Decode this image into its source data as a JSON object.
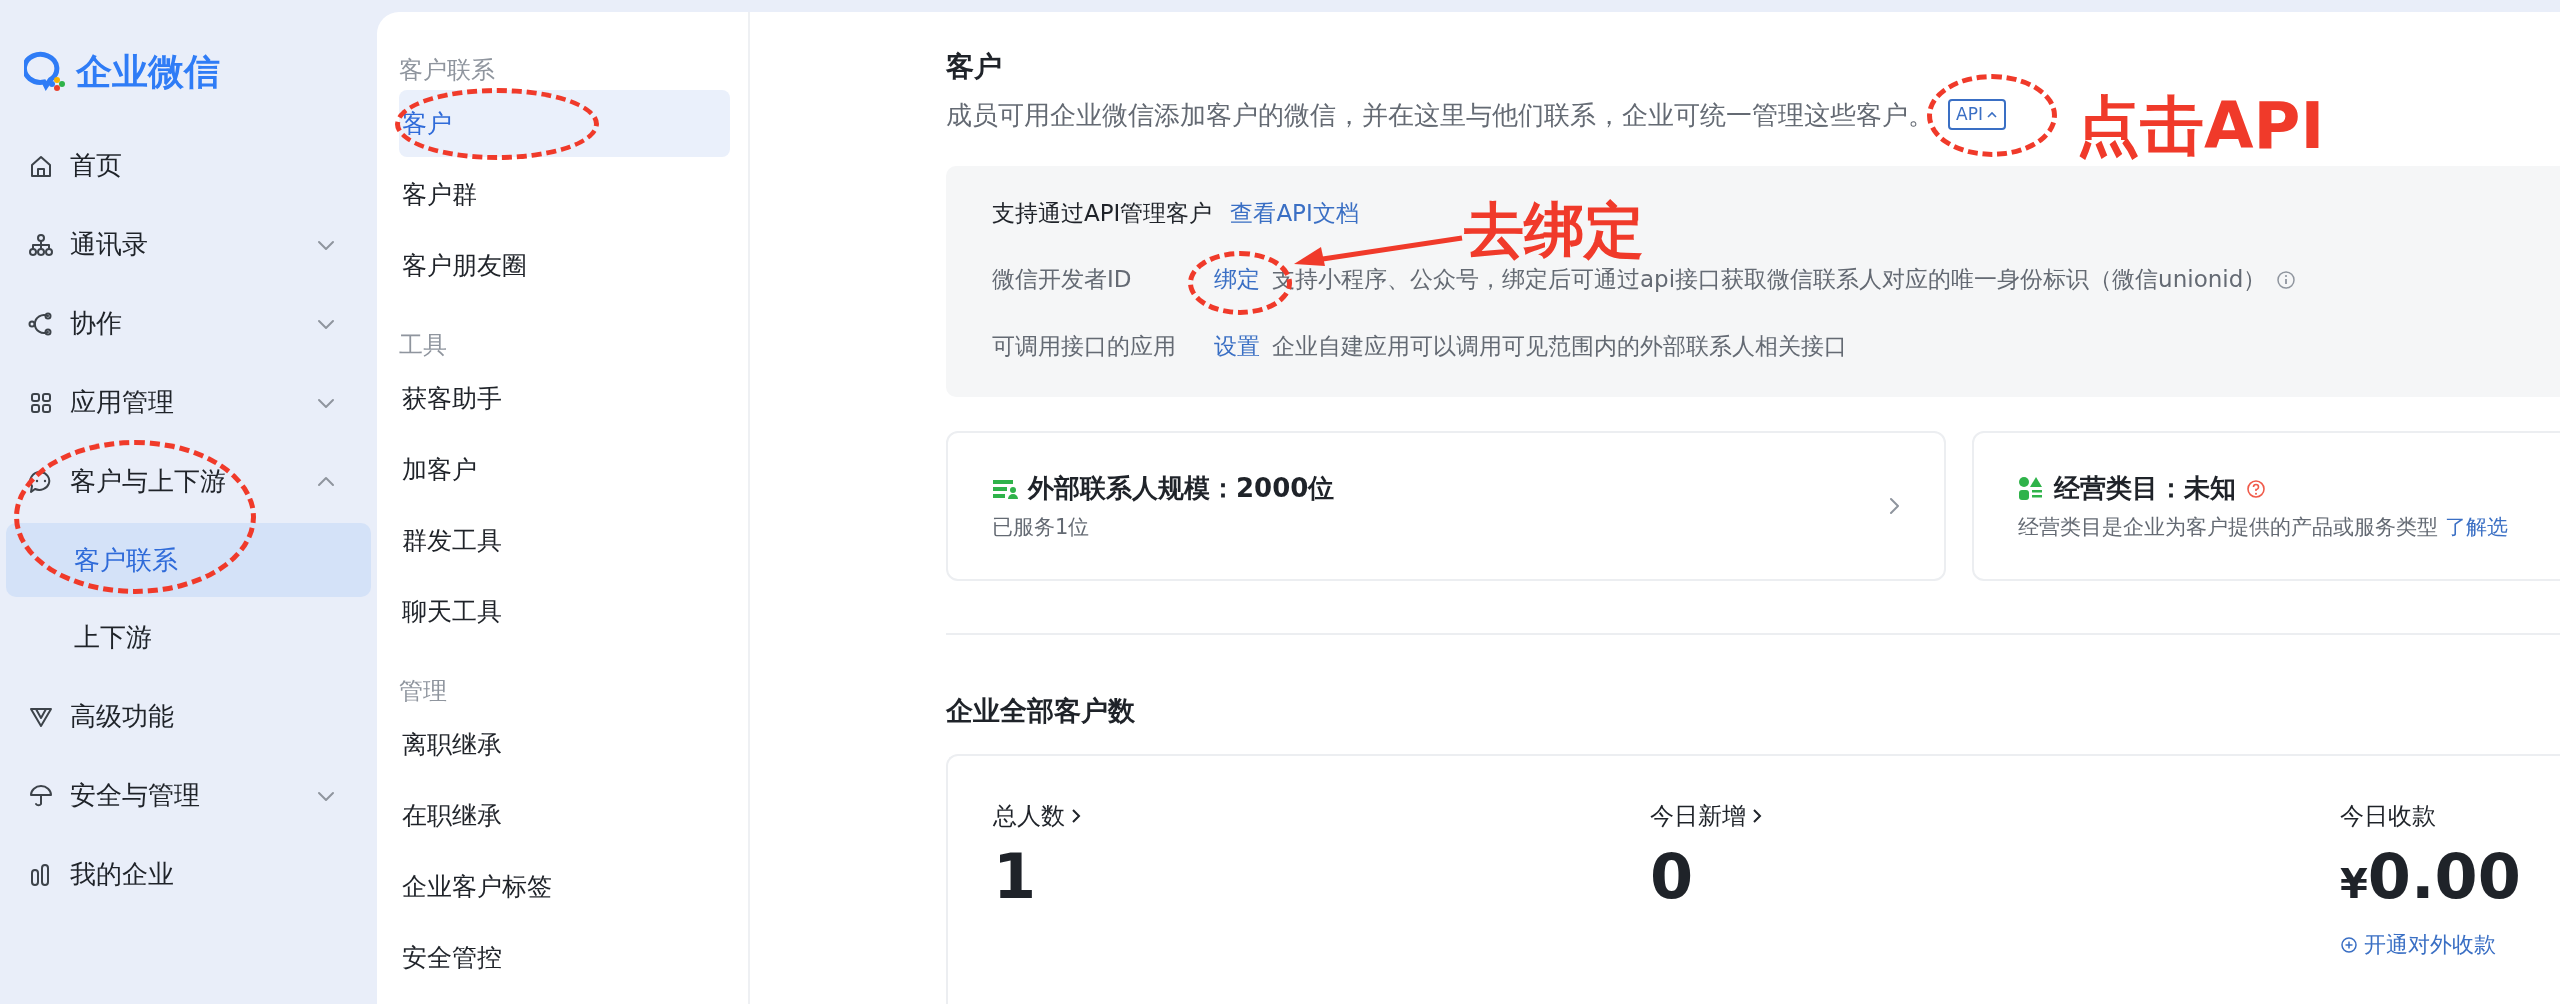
{
  "logo": {
    "text": "企业微信"
  },
  "sidebar": {
    "items": [
      {
        "label": "首页"
      },
      {
        "label": "通讯录",
        "expanded": false
      },
      {
        "label": "协作",
        "expanded": false
      },
      {
        "label": "应用管理",
        "expanded": false
      },
      {
        "label": "客户与上下游",
        "expanded": true,
        "children": [
          {
            "label": "客户联系",
            "selected": true
          },
          {
            "label": "上下游",
            "selected": false
          }
        ]
      },
      {
        "label": "高级功能"
      },
      {
        "label": "安全与管理",
        "expanded": false
      },
      {
        "label": "我的企业"
      }
    ]
  },
  "sub_nav": {
    "sections": [
      {
        "title": "客户联系",
        "items": [
          {
            "label": "客户",
            "selected": true
          },
          {
            "label": "客户群",
            "selected": false
          },
          {
            "label": "客户朋友圈",
            "selected": false
          }
        ]
      },
      {
        "title": "工具",
        "items": [
          {
            "label": "获客助手",
            "selected": false
          },
          {
            "label": "加客户",
            "selected": false
          },
          {
            "label": "群发工具",
            "selected": false
          },
          {
            "label": "聊天工具",
            "selected": false
          }
        ]
      },
      {
        "title": "管理",
        "items": [
          {
            "label": "离职继承",
            "selected": false
          },
          {
            "label": "在职继承",
            "selected": false
          },
          {
            "label": "企业客户标签",
            "selected": false
          },
          {
            "label": "安全管控",
            "selected": false
          }
        ]
      }
    ]
  },
  "main": {
    "title": "客户",
    "description": "成员可用企业微信添加客户的微信，并在这里与他们联系，企业可统一管理这些客户。",
    "api_badge": "API",
    "api_panel": {
      "heading": "支持通过API管理客户",
      "heading_link": "查看API文档",
      "rows": [
        {
          "label": "微信开发者ID",
          "action": "绑定",
          "text": "支持小程序、公众号，绑定后可通过api接口获取微信联系人对应的唯一身份标识（微信unionid）",
          "info": true
        },
        {
          "label": "可调用接口的应用",
          "action": "设置",
          "text": "企业自建应用可以调用可见范围内的外部联系人相关接口",
          "info": false
        }
      ]
    },
    "cards": [
      {
        "kind": "scale",
        "title": "外部联系人规模：2000位",
        "subtitle": "已服务1位"
      },
      {
        "kind": "category",
        "title": "经营类目：未知",
        "subtitle": "经营类目是企业为客户提供的产品或服务类型",
        "link": "了解选"
      }
    ],
    "section_title": "企业全部客户数",
    "stats": [
      {
        "label": "总人数",
        "linked": true,
        "value": "1"
      },
      {
        "label": "今日新增",
        "linked": true,
        "value": "0"
      },
      {
        "label": "今日收款",
        "linked": false,
        "currency": "¥",
        "value": "0.00",
        "action": "开通对外收款"
      }
    ]
  },
  "annotations": [
    {
      "text": "点击API"
    },
    {
      "text": "去绑定"
    }
  ]
}
